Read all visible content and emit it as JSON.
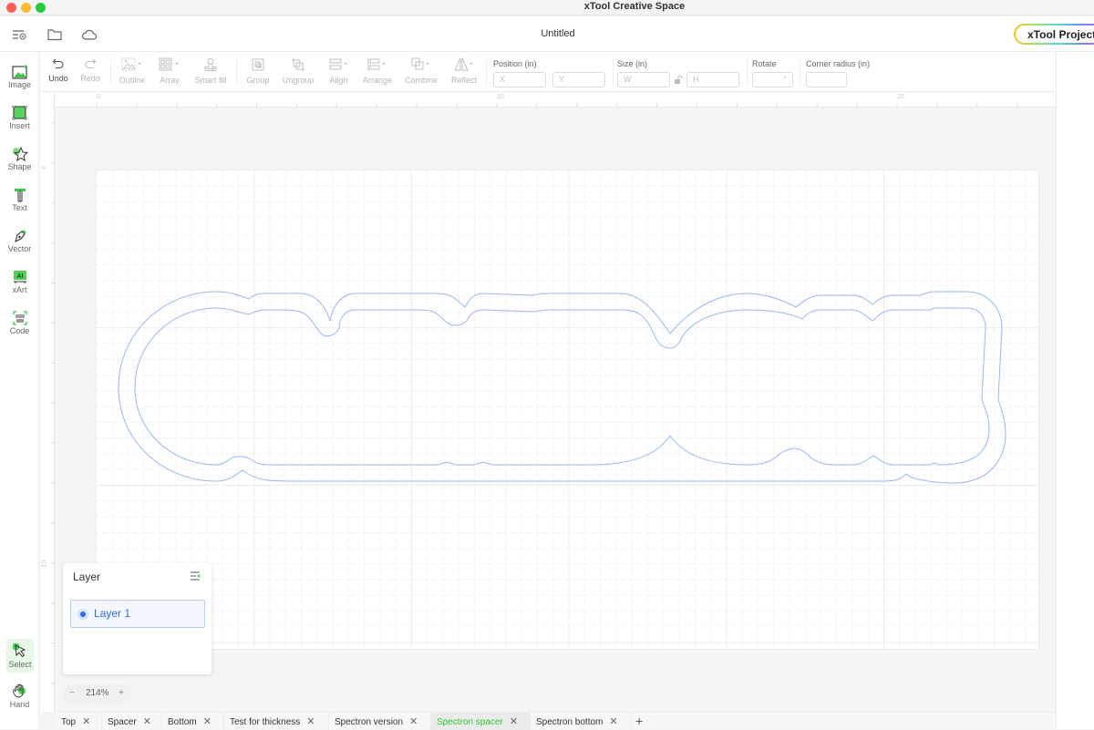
{
  "window": {
    "app_title": "xTool Creative Space"
  },
  "header": {
    "doc_title": "Untitled",
    "project_button": "xTool Project"
  },
  "left_tools": [
    {
      "id": "image",
      "label": "Image",
      "icon": "image-icon"
    },
    {
      "id": "insert",
      "label": "Insert",
      "icon": "insert-icon"
    },
    {
      "id": "shape",
      "label": "Shape",
      "icon": "shape-icon"
    },
    {
      "id": "text",
      "label": "Text",
      "icon": "text-icon"
    },
    {
      "id": "vector",
      "label": "Vector",
      "icon": "pen-icon"
    },
    {
      "id": "xart",
      "label": "xArt",
      "icon": "ai-icon"
    },
    {
      "id": "code",
      "label": "Code",
      "icon": "barcode-icon"
    }
  ],
  "bottom_tools": [
    {
      "id": "select",
      "label": "Select",
      "icon": "cursor-icon",
      "active": true
    },
    {
      "id": "hand",
      "label": "Hand",
      "icon": "hand-icon",
      "active": false
    }
  ],
  "toolbar": {
    "undo": "Undo",
    "redo": "Redo",
    "outline": "Outline",
    "array": "Array",
    "smart_fill": "Smart fill",
    "group": "Group",
    "ungroup": "Ungroup",
    "align": "Align",
    "arrange": "Arrange",
    "combine": "Combine",
    "reflect": "Reflect",
    "position_label": "Position (in)",
    "x_placeholder": "X",
    "y_placeholder": "Y",
    "size_label": "Size (in)",
    "w_placeholder": "W",
    "h_placeholder": "H",
    "rotate_label": "Rotate",
    "rotate_unit": "°",
    "corner_radius_label": "Corner radius (in)"
  },
  "rulers": {
    "top": [
      "0",
      "10",
      "20"
    ],
    "left": [
      "0",
      "10"
    ]
  },
  "layer_panel": {
    "title": "Layer",
    "layers": [
      {
        "name": "Layer 1",
        "selected": true
      }
    ]
  },
  "zoom": {
    "minus": "−",
    "value": "214%",
    "plus": "+"
  },
  "tabs": [
    {
      "label": "Top",
      "active": false
    },
    {
      "label": "Spacer",
      "active": false
    },
    {
      "label": "Bottom",
      "active": false
    },
    {
      "label": "Test for thickness",
      "active": false
    },
    {
      "label": "Spectron version",
      "active": false
    },
    {
      "label": "Spectron spacer",
      "active": true
    },
    {
      "label": "Spectron bottom",
      "active": false
    }
  ],
  "tab_close": "✕",
  "tab_add": "+",
  "colors": {
    "accent_green": "#2ec832",
    "selection_blue": "#2d6ff0",
    "path_stroke": "#9db5f5"
  }
}
